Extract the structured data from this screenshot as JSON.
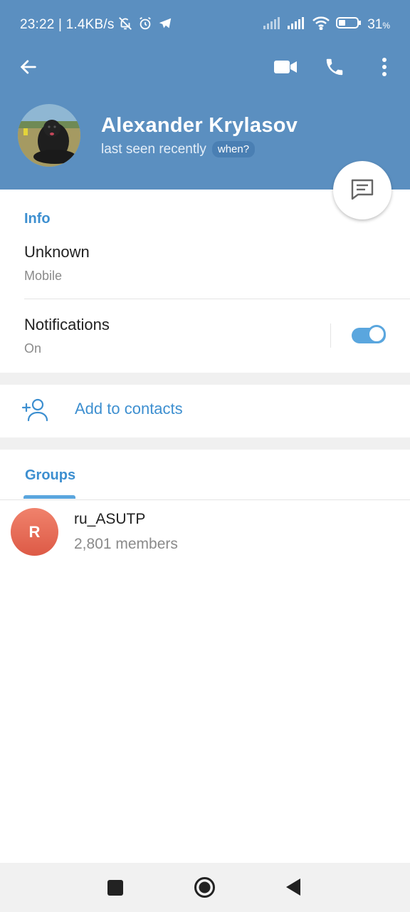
{
  "status_bar": {
    "time": "23:22 | 1.4KB/s",
    "battery": "31",
    "battery_unit": "%",
    "icons": [
      "bell-off-icon",
      "alarm-icon",
      "telegram-icon",
      "signal-icon",
      "signal-icon",
      "wifi-icon",
      "battery-icon"
    ]
  },
  "toolbar": {
    "icons": [
      "back-arrow-icon",
      "video-call-icon",
      "phone-icon",
      "more-vert-icon"
    ]
  },
  "profile": {
    "name": "Alexander Krylasov",
    "last_seen": "last seen recently",
    "when_badge": "when?"
  },
  "info": {
    "section_title": "Info",
    "phone_value": "Unknown",
    "phone_label": "Mobile",
    "notifications_title": "Notifications",
    "notifications_state": "On",
    "notifications_enabled": true
  },
  "actions": {
    "add_contact_label": "Add to contacts"
  },
  "groups": {
    "tab_label": "Groups",
    "items": [
      {
        "initial": "R",
        "name": "ru_ASUTP",
        "members": "2,801 members",
        "avatar_color": "#e4624d"
      }
    ]
  },
  "colors": {
    "header": "#5b8fc0",
    "accent": "#3d8fd0",
    "toggle": "#5aa6de"
  },
  "navbar": {
    "icons": [
      "recents-square-icon",
      "home-circle-icon",
      "back-triangle-icon"
    ]
  }
}
